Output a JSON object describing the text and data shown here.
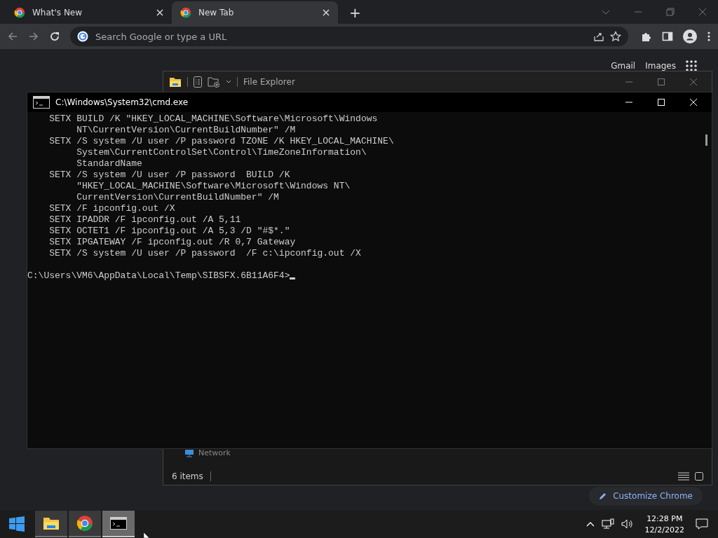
{
  "browser": {
    "tabs": [
      {
        "title": "What's New",
        "selected": false
      },
      {
        "title": "New Tab",
        "selected": true
      }
    ],
    "new_tab_button": "+",
    "address_bar": {
      "placeholder": "Search Google or type a URL"
    },
    "links": [
      "Gmail",
      "Images"
    ],
    "customize_button": "Customize Chrome"
  },
  "file_explorer": {
    "title": "File Explorer",
    "sidebar_item": "Network",
    "status": "6 items"
  },
  "cmd": {
    "title": "C:\\Windows\\System32\\cmd.exe",
    "lines": [
      "    SETX BUILD /K \"HKEY_LOCAL_MACHINE\\Software\\Microsoft\\Windows",
      "         NT\\CurrentVersion\\CurrentBuildNumber\" /M",
      "    SETX /S system /U user /P password TZONE /K HKEY_LOCAL_MACHINE\\",
      "         System\\CurrentControlSet\\Control\\TimeZoneInformation\\",
      "         StandardName",
      "    SETX /S system /U user /P password  BUILD /K",
      "         \"HKEY_LOCAL_MACHINE\\Software\\Microsoft\\Windows NT\\",
      "         CurrentVersion\\CurrentBuildNumber\" /M",
      "    SETX /F ipconfig.out /X",
      "    SETX IPADDR /F ipconfig.out /A 5,11",
      "    SETX OCTET1 /F ipconfig.out /A 5,3 /D \"#$*.\"",
      "    SETX IPGATEWAY /F ipconfig.out /R 0,7 Gateway",
      "    SETX /S system /U user /P password  /F c:\\ipconfig.out /X"
    ],
    "prompt": "C:\\Users\\VM6\\AppData\\Local\\Temp\\SIBSFX.6B11A6F4>"
  },
  "taskbar": {
    "apps": [
      {
        "kind": "explorer",
        "selected": false
      },
      {
        "kind": "chrome",
        "selected": false
      },
      {
        "kind": "cmd",
        "selected": true
      }
    ],
    "time": "12:28 PM",
    "date": "12/2/2022"
  }
}
